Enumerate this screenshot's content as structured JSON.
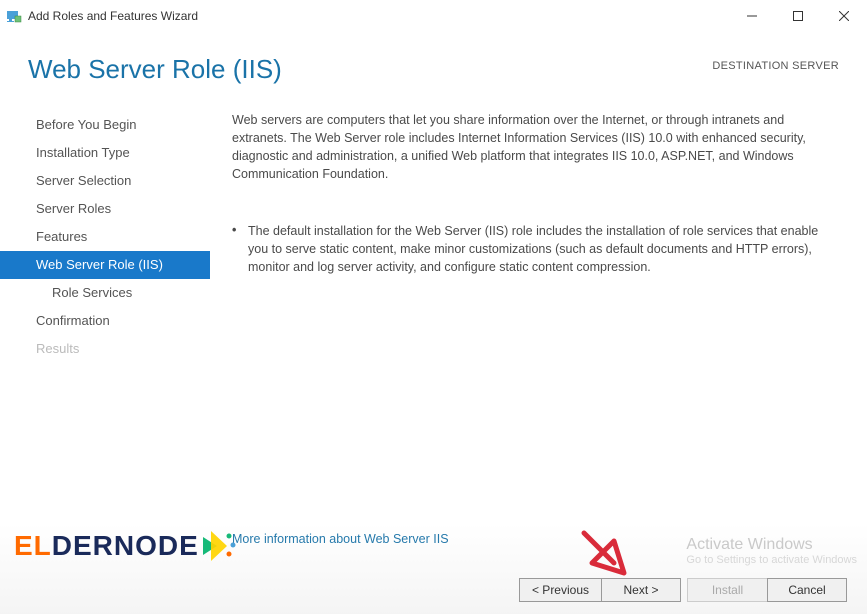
{
  "window": {
    "title": "Add Roles and Features Wizard",
    "controls": {
      "minimize": "—",
      "maximize": "☐",
      "close": "✕"
    }
  },
  "header": {
    "page_title": "Web Server Role (IIS)",
    "destination_label": "DESTINATION SERVER"
  },
  "sidebar": {
    "items": [
      {
        "label": "Before You Begin",
        "active": false,
        "child": false,
        "disabled": false
      },
      {
        "label": "Installation Type",
        "active": false,
        "child": false,
        "disabled": false
      },
      {
        "label": "Server Selection",
        "active": false,
        "child": false,
        "disabled": false
      },
      {
        "label": "Server Roles",
        "active": false,
        "child": false,
        "disabled": false
      },
      {
        "label": "Features",
        "active": false,
        "child": false,
        "disabled": false
      },
      {
        "label": "Web Server Role (IIS)",
        "active": true,
        "child": false,
        "disabled": false
      },
      {
        "label": "Role Services",
        "active": false,
        "child": true,
        "disabled": false
      },
      {
        "label": "Confirmation",
        "active": false,
        "child": false,
        "disabled": false
      },
      {
        "label": "Results",
        "active": false,
        "child": false,
        "disabled": true
      }
    ]
  },
  "content": {
    "intro": "Web servers are computers that let you share information over the Internet, or through intranets and extranets. The Web Server role includes Internet Information Services (IIS) 10.0 with enhanced security, diagnostic and administration, a unified Web platform that integrates IIS 10.0, ASP.NET, and Windows Communication Foundation.",
    "bullet1": "The default installation for the Web Server (IIS) role includes the installation of role services that enable you to serve static content, make minor customizations (such as default documents and HTTP errors), monitor and log server activity, and configure static content compression.",
    "more_info": "More information about Web Server IIS"
  },
  "footer": {
    "previous": "< Previous",
    "next": "Next >",
    "install": "Install",
    "cancel": "Cancel"
  },
  "watermark": {
    "title": "Activate Windows",
    "sub": "Go to Settings to activate Windows"
  },
  "logo": {
    "p1": "EL",
    "p2": "DER",
    "p3": "NODE"
  }
}
